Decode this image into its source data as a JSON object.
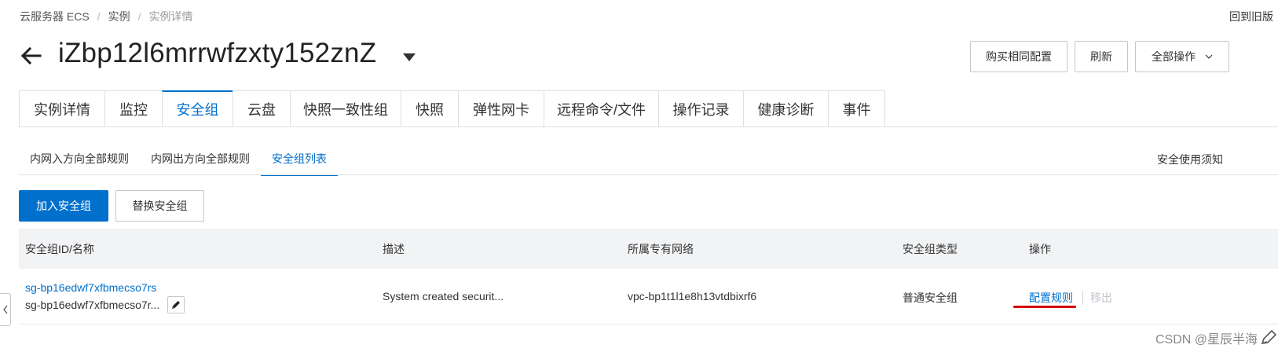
{
  "breadcrumb": {
    "items": [
      "云服务器 ECS",
      "实例",
      "实例详情"
    ],
    "separator": "/"
  },
  "header": {
    "back_old_version": "回到旧版",
    "instance_id": "iZbp12l6mrrwfzxty152znZ",
    "buttons": {
      "buy_same": "购买相同配置",
      "refresh": "刷新",
      "all_actions": "全部操作"
    }
  },
  "main_tabs": [
    {
      "label": "实例详情"
    },
    {
      "label": "监控"
    },
    {
      "label": "安全组"
    },
    {
      "label": "云盘"
    },
    {
      "label": "快照一致性组"
    },
    {
      "label": "快照"
    },
    {
      "label": "弹性网卡"
    },
    {
      "label": "远程命令/文件"
    },
    {
      "label": "操作记录"
    },
    {
      "label": "健康诊断"
    },
    {
      "label": "事件"
    }
  ],
  "active_main_tab": "安全组",
  "sub_tabs": [
    {
      "label": "内网入方向全部规则"
    },
    {
      "label": "内网出方向全部规则"
    },
    {
      "label": "安全组列表"
    }
  ],
  "active_sub_tab": "安全组列表",
  "security_note": "安全使用须知",
  "actions": {
    "add": "加入安全组",
    "replace": "替换安全组"
  },
  "table": {
    "columns": [
      "安全组ID/名称",
      "描述",
      "所属专有网络",
      "安全组类型",
      "操作"
    ],
    "rows": [
      {
        "id": "sg-bp16edwf7xfbmecso7rs",
        "name": "sg-bp16edwf7xfbmecso7r...",
        "description": "System created securit...",
        "vpc": "vpc-bp1t1l1e8h13vtdbixrf6",
        "type": "普通安全组",
        "op_configure": "配置规则",
        "op_remove": "移出"
      }
    ]
  },
  "watermark": "CSDN @星辰半海",
  "colors": {
    "primary": "#0070cc",
    "annotation_red": "#d40000",
    "header_bg": "#f2f3f5"
  }
}
